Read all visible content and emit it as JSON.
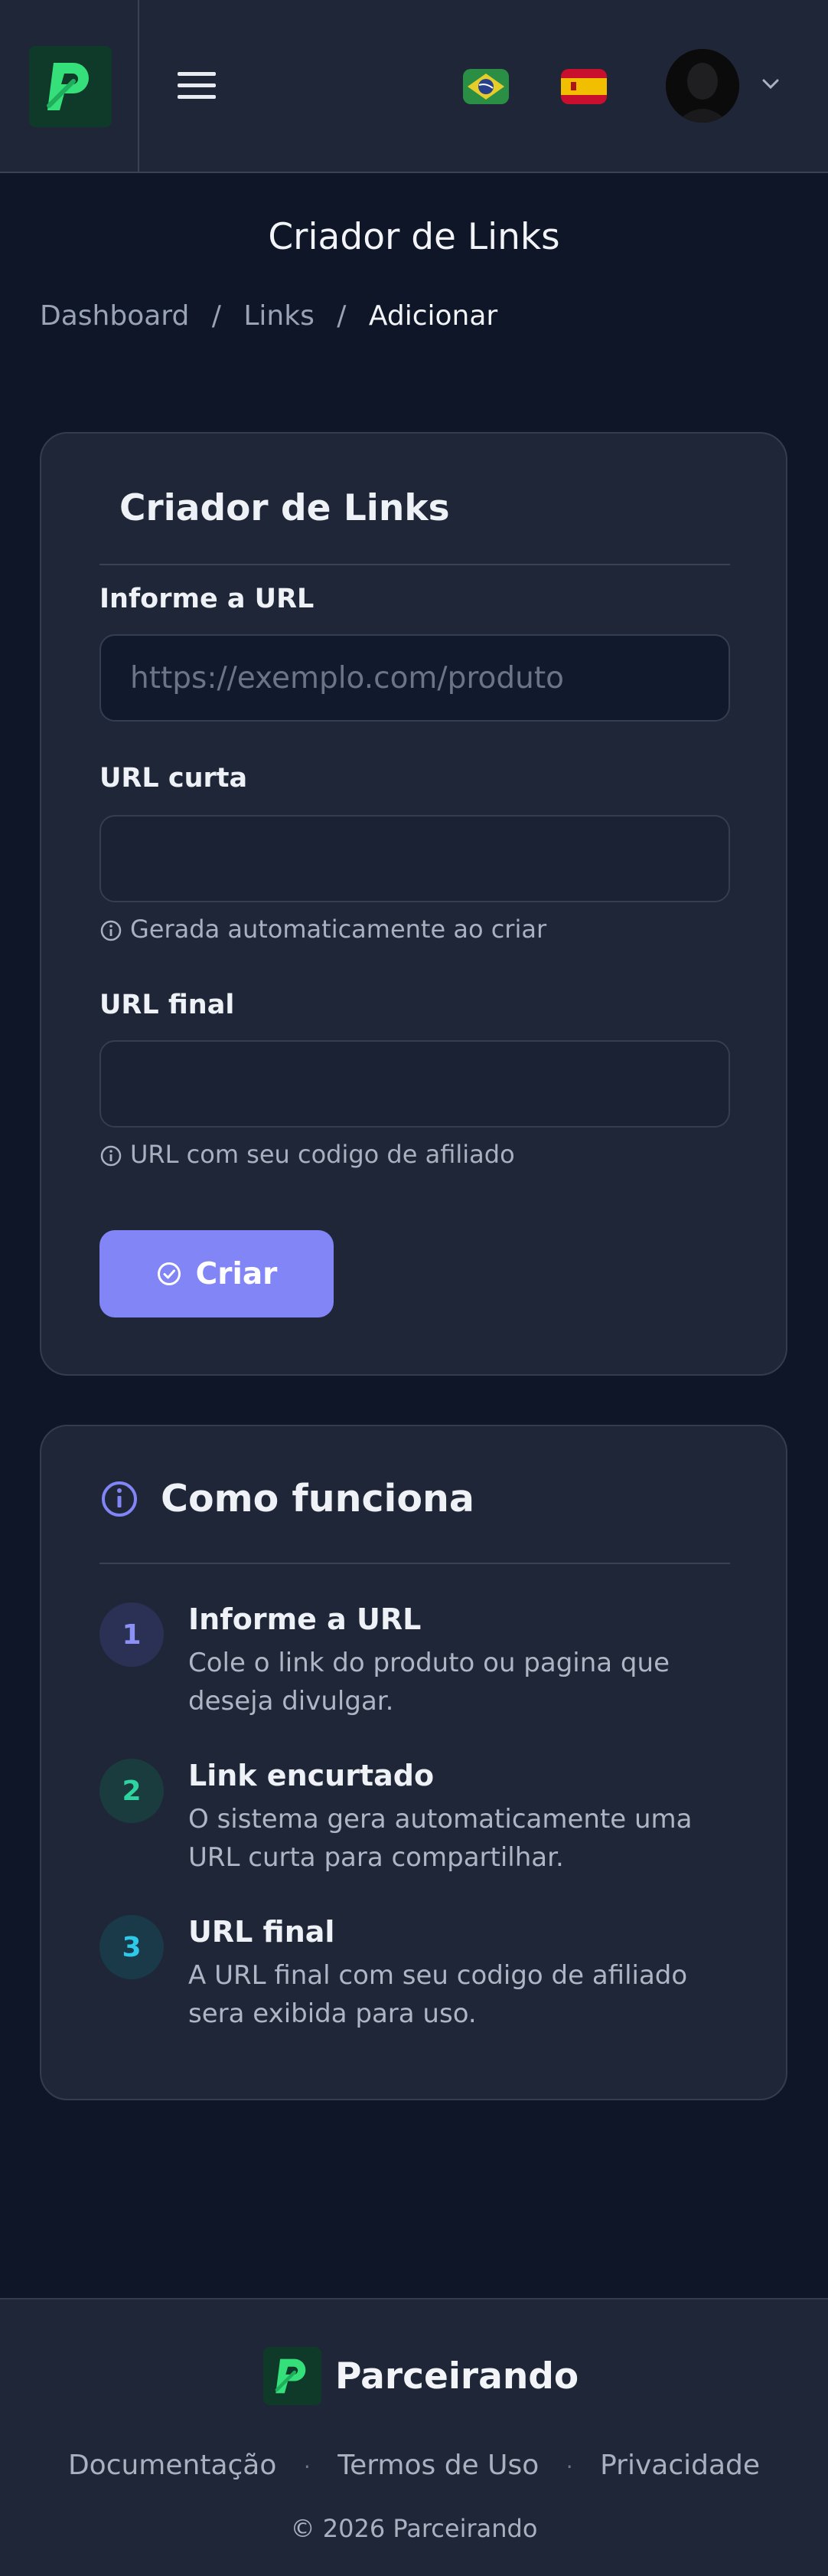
{
  "header": {
    "logo_letter": "P",
    "flags": [
      "brazil-flag",
      "spain-flag"
    ],
    "colors": {
      "brand_green": "#35e07a",
      "accent": "#8185f5",
      "background": "#0e1628",
      "surface": "#1e2637"
    }
  },
  "page": {
    "title": "Criador de Links",
    "breadcrumb": {
      "items": [
        "Dashboard",
        "Links"
      ],
      "current": "Adicionar",
      "separator": "/"
    }
  },
  "form": {
    "heading": "Criador de Links",
    "url_label": "Informe a URL",
    "url_placeholder": "https://exemplo.com/produto",
    "url_value": "",
    "short_label": "URL curta",
    "short_value": "",
    "short_hint": "Gerada automaticamente ao criar",
    "final_label": "URL final",
    "final_value": "",
    "final_hint": "URL com seu codigo de afiliado",
    "submit_label": "Criar"
  },
  "info": {
    "title": "Como funciona",
    "steps": [
      {
        "num": "1",
        "title": "Informe a URL",
        "desc": "Cole o link do produto ou pagina que deseja divulgar."
      },
      {
        "num": "2",
        "title": "Link encurtado",
        "desc": "O sistema gera automaticamente uma URL curta para compartilhar."
      },
      {
        "num": "3",
        "title": "URL final",
        "desc": "A URL final com seu codigo de afiliado sera exibida para uso."
      }
    ]
  },
  "footer": {
    "brand": "Parceirando",
    "links": [
      "Documentação",
      "Termos de Uso",
      "Privacidade"
    ],
    "link_separator": "·",
    "copyright": "© 2026 Parceirando"
  }
}
